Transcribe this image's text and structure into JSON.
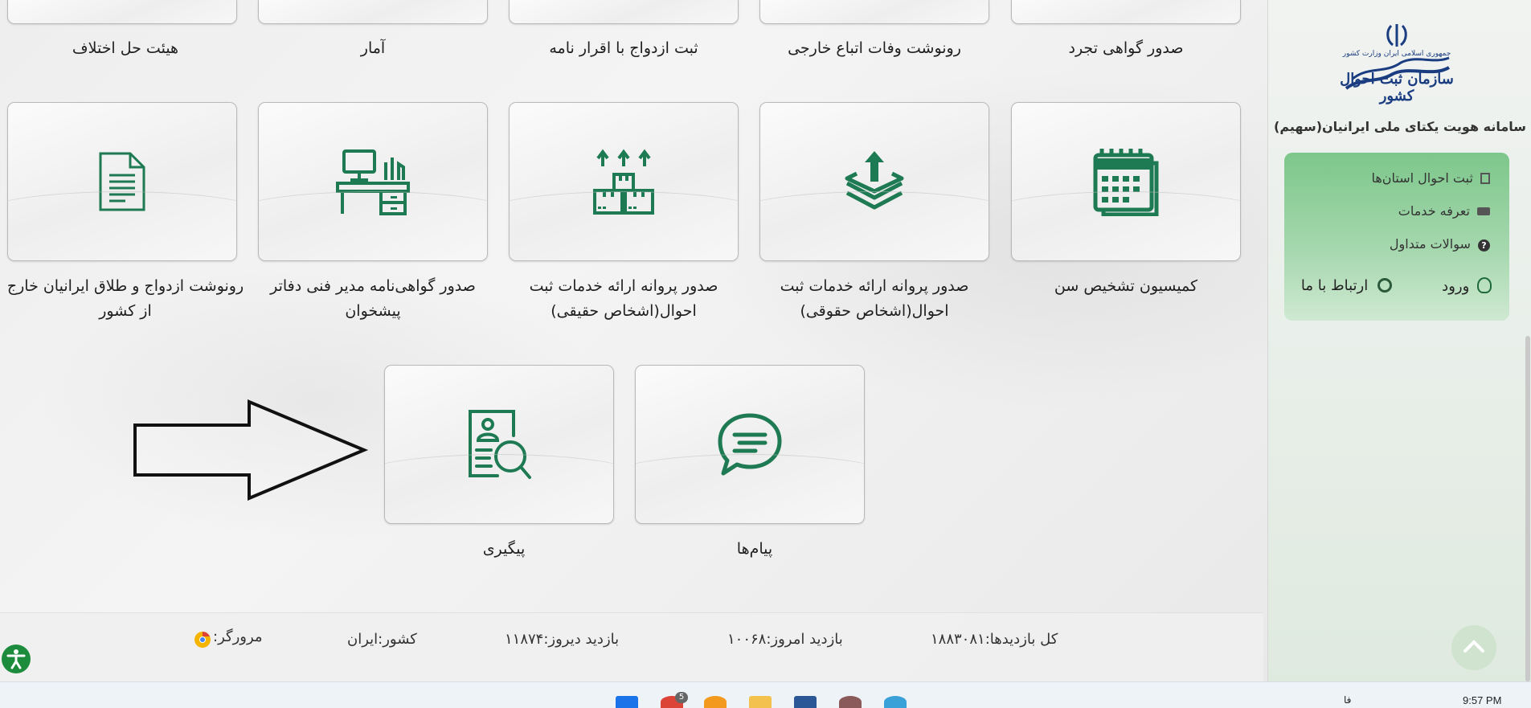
{
  "top_row_labels": [
    "صدور گواهی تجرد",
    "رونوشت وفات اتباع خارجی",
    "ثبت ازدواج با اقرار نامه",
    "آمار",
    "هیئت حل اختلاف"
  ],
  "tiles_row2": [
    {
      "label": "کمیسیون تشخیص سن",
      "icon": "calendar-icon"
    },
    {
      "label": "صدور پروانه ارائه خدمات ثبت احوال(اشخاص حقوقی)",
      "icon": "layers-upload-icon"
    },
    {
      "label": "صدور پروانه ارائه خدمات ثبت احوال(اشخاص حقیقی)",
      "icon": "boxes-icon"
    },
    {
      "label": "صدور گواهی‌نامه مدیر فنی دفاتر پیشخوان",
      "icon": "desk-icon"
    },
    {
      "label": "رونوشت ازدواج و طلاق ایرانیان خارج از کشور",
      "icon": "document-icon"
    }
  ],
  "tiles_row3": [
    {
      "label": "پیام‌ها",
      "icon": "chat-icon"
    },
    {
      "label": "پیگیری",
      "icon": "search-profile-icon"
    }
  ],
  "footer": {
    "total_visits": "کل بازدیدها:۱۸۸۳۰۸۱",
    "today_visits": "بازدید امروز:۱۰۰۶۸",
    "yesterday_visits": "بازدید دیروز:۱۱۸۷۴",
    "country": "کشور:ایران",
    "browser": "مرورگر:"
  },
  "sidebar": {
    "logo_text": "سازمان ثبت احوال کشور",
    "logo_small": "جمهوری اسلامی ایران وزارت کشور",
    "title": "سامانه هویت یکتای ملی ایرانیان(سهیم)",
    "menu": [
      {
        "label": "ثبت احوال استان‌ها",
        "icon": "building-icon"
      },
      {
        "label": "تعرفه خدمات",
        "icon": "money-icon"
      },
      {
        "label": "سوالات متداول",
        "icon": "question-icon"
      }
    ],
    "login_label": "ورود",
    "contact_label": "ارتباط با ما"
  },
  "taskbar": {
    "time": "9:57 PM",
    "lang": "فا",
    "badge": "5"
  },
  "colors": {
    "accent_green": "#1e7a53",
    "menu_green": "#7dc78b"
  }
}
